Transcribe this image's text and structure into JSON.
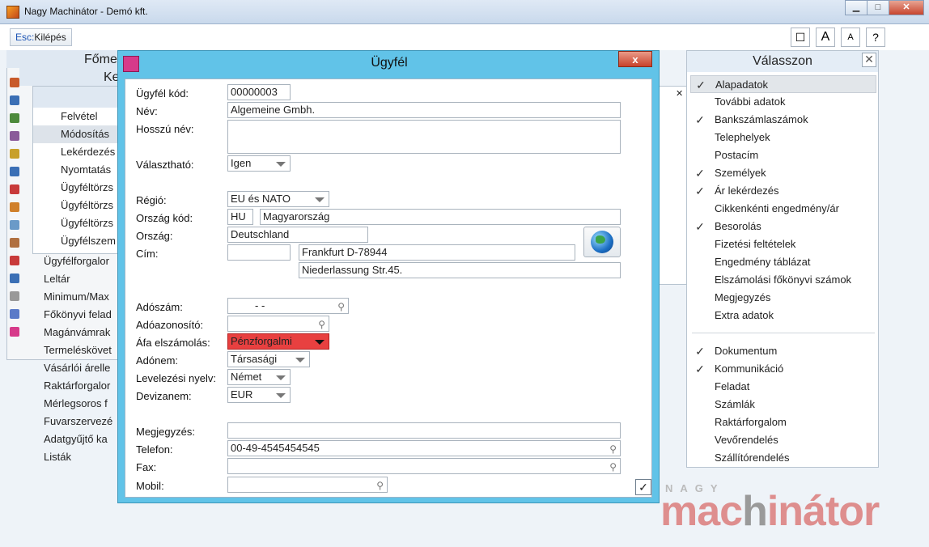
{
  "window": {
    "title": "Nagy Machinátor - Demó kft.",
    "buttons": [
      "▁",
      "□",
      "✕"
    ]
  },
  "toolbar": {
    "exit_key": "Esc:",
    "exit_label": "Kilépés",
    "icons": [
      "window-icon",
      "font-large-icon",
      "font-small-icon",
      "help-icon"
    ],
    "icon_glyphs": [
      "☐",
      "A",
      "A",
      "?"
    ]
  },
  "background": {
    "fomenu_title": "Főme",
    "panel2_title": "Ke",
    "submenu": [
      "Felvétel",
      "Módosítás",
      "Lekérdezés",
      "Nyomtatás",
      "Ügyféltörzs",
      "Ügyféltörzs",
      "Ügyféltörzs",
      "Ügyfélszem"
    ],
    "menu": [
      "Ügyfélforgalor",
      "Leltár",
      "Minimum/Max",
      "Főkönyvi felad",
      "Magánvámrak",
      "Termeléskövet",
      "Vásárlói árelle",
      "Raktárforgalor",
      "Mérlegsoros f",
      "Fuvarszervezé",
      "Adatgyűjtő ka",
      "Listák"
    ]
  },
  "dialog": {
    "title": "Ügyfél",
    "close": "x",
    "fields": {
      "ugyfel_kod_label": "Ügyfél kód:",
      "ugyfel_kod": "00000003",
      "nev_label": "Név:",
      "nev": "Algemeine Gmbh.",
      "hosszu_nev_label": "Hosszú név:",
      "hosszu_nev": "",
      "valaszthato_label": "Választható:",
      "valaszthato": "Igen",
      "regio_label": "Régió:",
      "regio": "EU és NATO",
      "orszag_kod_label": "Ország kód:",
      "orszag_kod": "HU",
      "orszag_kod_nev": "Magyarország",
      "orszag_label": "Ország:",
      "orszag": "Deutschland",
      "cim_label": "Cím:",
      "cim_zip": "",
      "cim_city": "Frankfurt D-78944",
      "cim_street": "Niederlassung Str.45.",
      "adoszam_label": "Adószám:",
      "adoszam": " - -",
      "adoazonosito_label": "Adóazonosító:",
      "adoazonosito": "",
      "afa_label": "Áfa elszámolás:",
      "afa": "Pénzforgalmi",
      "adonem_label": "Adónem:",
      "adonem": "Társasági",
      "nyelv_label": "Levelezési nyelv:",
      "nyelv": "Német",
      "deviza_label": "Devizanem:",
      "deviza": "EUR",
      "megjegyzes_label": "Megjegyzés:",
      "megjegyzes": "",
      "telefon_label": "Telefon:",
      "telefon": "00-49-4545454545",
      "fax_label": "Fax:",
      "fax": "",
      "mobil_label": "Mobil:",
      "mobil": ""
    },
    "ok": "✓"
  },
  "choose": {
    "title": "Válasszon",
    "close": "✕",
    "group1": [
      {
        "label": "Alapadatok",
        "checked": true,
        "selected": true
      },
      {
        "label": "További adatok",
        "checked": false
      },
      {
        "label": "Bankszámlaszámok",
        "checked": true
      },
      {
        "label": "Telephelyek",
        "checked": false
      },
      {
        "label": "Postacím",
        "checked": false
      },
      {
        "label": "Személyek",
        "checked": true
      },
      {
        "label": "Ár lekérdezés",
        "checked": true
      },
      {
        "label": "Cikkenkénti engedmény/ár",
        "checked": false
      },
      {
        "label": "Besorolás",
        "checked": true
      },
      {
        "label": "Fizetési feltételek",
        "checked": false
      },
      {
        "label": "Engedmény táblázat",
        "checked": false
      },
      {
        "label": "Elszámolási főkönyvi számok",
        "checked": false
      },
      {
        "label": "Megjegyzés",
        "checked": false
      },
      {
        "label": "Extra adatok",
        "checked": false
      }
    ],
    "group2": [
      {
        "label": "Dokumentum",
        "checked": true
      },
      {
        "label": "Kommunikáció",
        "checked": true
      },
      {
        "label": "Feladat",
        "checked": false
      },
      {
        "label": "Számlák",
        "checked": false
      },
      {
        "label": "Raktárforgalom",
        "checked": false
      },
      {
        "label": "Vevőrendelés",
        "checked": false
      },
      {
        "label": "Szállítórendelés",
        "checked": false
      }
    ]
  },
  "watermark": {
    "top": "NAGY",
    "brand_a": "mac",
    "brand_b": "h",
    "brand_c": "inátor"
  },
  "colors": {
    "dialog_frame": "#61c3e8",
    "highlight_red": "#e84040",
    "brand_pink": "#de8e8e"
  }
}
